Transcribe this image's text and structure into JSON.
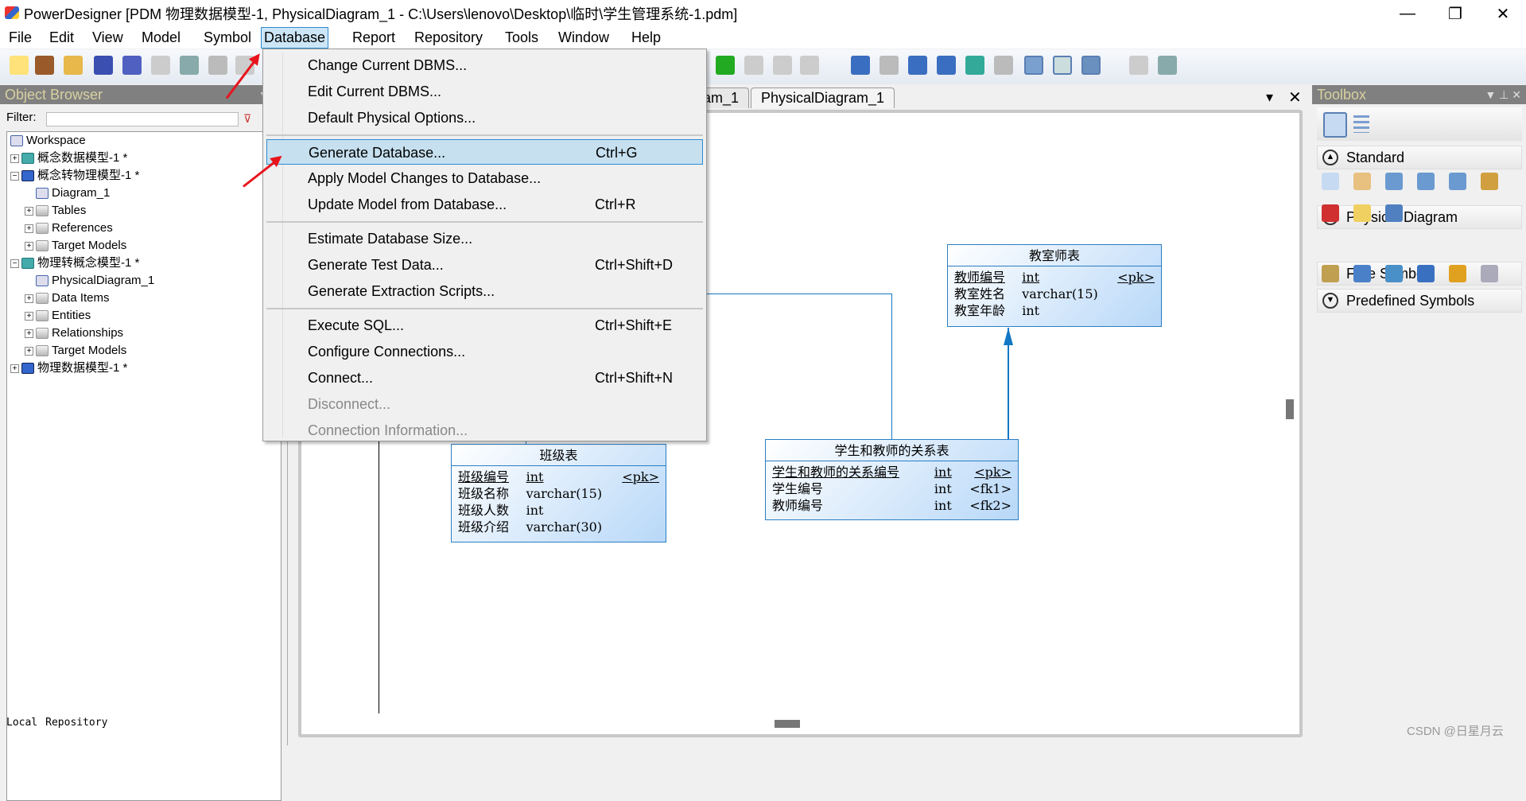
{
  "window": {
    "title": "PowerDesigner [PDM 物理数据模型-1, PhysicalDiagram_1 - C:\\Users\\lenovo\\Desktop\\临时\\学生管理系统-1.pdm]",
    "minimize": "—",
    "maximize": "❐",
    "close": "✕"
  },
  "menubar": [
    "File",
    "Edit",
    "View",
    "Model",
    "Symbol",
    "Database",
    "Report",
    "Repository",
    "Tools",
    "Window",
    "Help"
  ],
  "toolbar": {
    "icons": [
      [
        "new-icon",
        "#ffe27a"
      ],
      [
        "open-project-icon",
        "#9a5a2a"
      ],
      [
        "open-icon",
        "#e8b84a"
      ],
      [
        "save-icon",
        "#3a4fb0"
      ],
      [
        "save-all-icon",
        "#5060c0"
      ],
      [
        "print-preview-icon",
        "#ccc"
      ],
      [
        "print-icon",
        "#8aa"
      ],
      [
        "cut-icon",
        "#bbb"
      ],
      [
        "copy-icon",
        "#ccc"
      ],
      [
        "text-icon",
        "#2a2"
      ],
      [
        "import-icon",
        "#ccc"
      ],
      [
        "undo-icon",
        "#ccc"
      ],
      [
        "redo-icon",
        "#ccc"
      ],
      [
        "diagram-icon",
        "#3a6ec0"
      ],
      [
        "diagram2-icon",
        "#bbb"
      ],
      [
        "page-icon",
        "#3a6ec0"
      ],
      [
        "pages-icon",
        "#3a6ec0"
      ],
      [
        "check-model-icon",
        "#3a9"
      ],
      [
        "model-icon",
        "#bbb"
      ],
      [
        "browser-icon",
        "#7aa0d0"
      ],
      [
        "output-icon",
        "#cdd"
      ],
      [
        "result-list-icon",
        "#6a90c0"
      ],
      [
        "zoom-preview-icon",
        "#ccc"
      ],
      [
        "print2-icon",
        "#8aa"
      ]
    ]
  },
  "object_browser": {
    "title": "Object Browser",
    "filter_label": "Filter:",
    "filter_value": "",
    "tree": [
      {
        "label": "Workspace",
        "icon": "diag",
        "level": 0,
        "pm": ""
      },
      {
        "label": "概念数据模型-1 *",
        "icon": "model",
        "level": 0,
        "pm": "+"
      },
      {
        "label": "概念转物理模型-1 *",
        "icon": "pmodel",
        "level": 0,
        "pm": "−"
      },
      {
        "label": "Diagram_1",
        "icon": "diag",
        "level": 1,
        "pm": ""
      },
      {
        "label": "Tables",
        "icon": "folder",
        "level": 1,
        "pm": "+"
      },
      {
        "label": "References",
        "icon": "folder",
        "level": 1,
        "pm": "+"
      },
      {
        "label": "Target Models",
        "icon": "folder",
        "level": 1,
        "pm": "+"
      },
      {
        "label": "物理转概念模型-1 *",
        "icon": "model",
        "level": 0,
        "pm": "−"
      },
      {
        "label": "PhysicalDiagram_1",
        "icon": "diag",
        "level": 1,
        "pm": ""
      },
      {
        "label": "Data Items",
        "icon": "folder",
        "level": 1,
        "pm": "+"
      },
      {
        "label": "Entities",
        "icon": "folder",
        "level": 1,
        "pm": "+"
      },
      {
        "label": "Relationships",
        "icon": "folder",
        "level": 1,
        "pm": "+"
      },
      {
        "label": "Target Models",
        "icon": "folder",
        "level": 1,
        "pm": "+"
      },
      {
        "label": "物理数据模型-1 *",
        "icon": "pmodel",
        "level": 0,
        "pm": "+"
      }
    ],
    "tabs": [
      "Local",
      "Repository"
    ]
  },
  "diagram_tabs": [
    "Diagram_1",
    "PhysicalDiagram_1"
  ],
  "database_menu": [
    {
      "label": "Change Current DBMS...",
      "shortcut": ""
    },
    {
      "label": "Edit Current DBMS...",
      "shortcut": ""
    },
    {
      "label": "Default Physical Options...",
      "shortcut": ""
    },
    {
      "sep": true
    },
    {
      "label": "Generate Database...",
      "shortcut": "Ctrl+G",
      "highlighted": true
    },
    {
      "label": "Apply Model Changes to Database...",
      "shortcut": ""
    },
    {
      "label": "Update Model from Database...",
      "shortcut": "Ctrl+R"
    },
    {
      "sep": true
    },
    {
      "label": "Estimate Database Size...",
      "shortcut": ""
    },
    {
      "label": "Generate Test Data...",
      "shortcut": "Ctrl+Shift+D"
    },
    {
      "label": "Generate Extraction Scripts...",
      "shortcut": ""
    },
    {
      "sep": true
    },
    {
      "label": "Execute SQL...",
      "shortcut": "Ctrl+Shift+E"
    },
    {
      "label": "Configure Connections...",
      "shortcut": ""
    },
    {
      "label": "Connect...",
      "shortcut": "Ctrl+Shift+N"
    },
    {
      "label": "Disconnect...",
      "shortcut": "",
      "disabled": true
    },
    {
      "label": "Connection Information...",
      "shortcut": "",
      "disabled": true
    }
  ],
  "tables": [
    {
      "name": "教室师表",
      "columns": [
        [
          "教师编号",
          "int",
          "<pk>",
          true
        ],
        [
          "教室姓名",
          "varchar(15)",
          "",
          false
        ],
        [
          "教室年龄",
          "int",
          "",
          false
        ]
      ]
    },
    {
      "name": "班级表",
      "columns": [
        [
          "班级编号",
          "int",
          "<pk>",
          true
        ],
        [
          "班级名称",
          "varchar(15)",
          "",
          false
        ],
        [
          "班级人数",
          "int",
          "",
          false
        ],
        [
          "班级介绍",
          "varchar(30)",
          "",
          false
        ]
      ]
    },
    {
      "name": "学生和教师的关系表",
      "columns": [
        [
          "学生和教师的关系编号",
          "int",
          "<pk>",
          true
        ],
        [
          "学生编号",
          "int",
          "<fk1>",
          false
        ],
        [
          "教师编号",
          "int",
          "<fk2>",
          false
        ]
      ]
    }
  ],
  "toolbox": {
    "title": "Toolbox",
    "sections": [
      "Standard",
      "Physical Diagram",
      "Free Symbols",
      "Predefined Symbols"
    ]
  },
  "watermark": "CSDN @日星月云",
  "colors": {
    "accent": "#2e8bd1",
    "link": "#1277c4",
    "annotation": "#e8141c"
  }
}
